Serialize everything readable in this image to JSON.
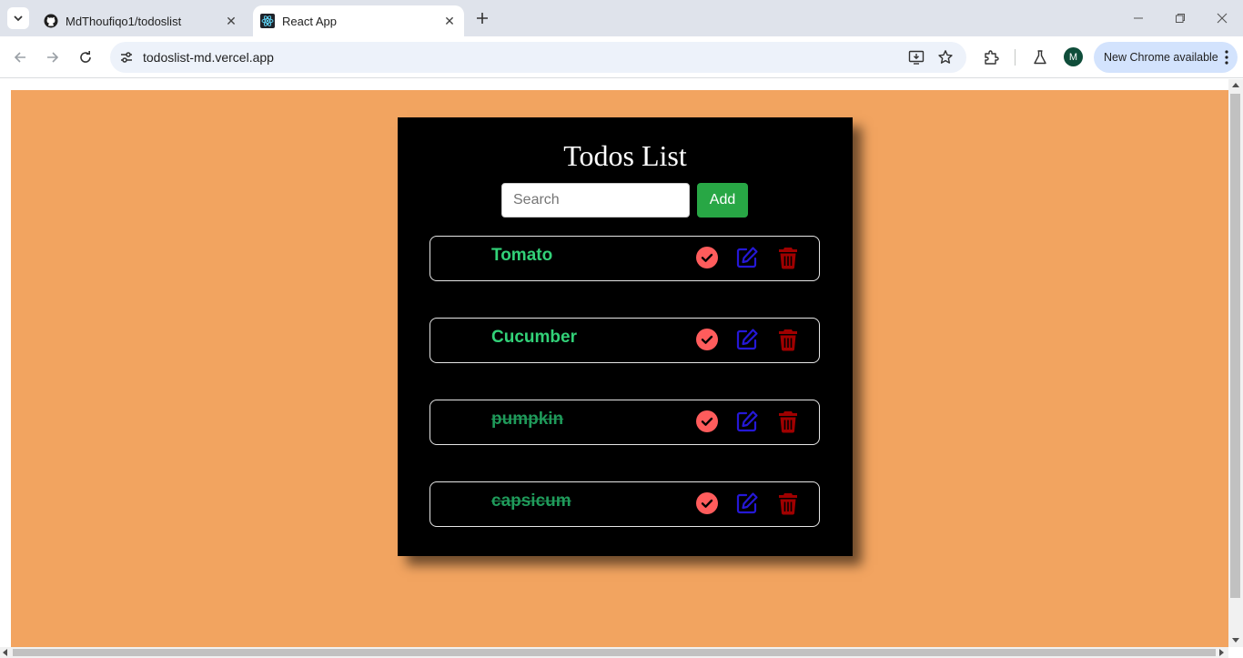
{
  "browser": {
    "tabs": [
      {
        "title": "MdThoufiqo1/todoslist",
        "icon": "github-icon",
        "active": false
      },
      {
        "title": "React App",
        "icon": "react-icon",
        "active": true
      }
    ],
    "address": "todoslist-md.vercel.app",
    "profile_initial": "M",
    "update_label": "New Chrome available"
  },
  "app": {
    "title": "Todos List",
    "search_placeholder": "Search",
    "search_value": "",
    "add_label": "Add",
    "colors": {
      "page_background": "#f2a460",
      "card": "#000000",
      "todo_text": "#32d178",
      "add_button": "#28a745",
      "done_icon": "#ff5c5c",
      "edit_icon": "#2518d6",
      "delete_icon": "#a00000"
    },
    "todos": [
      {
        "text": "Tomato",
        "completed": false
      },
      {
        "text": "Cucumber",
        "completed": false
      },
      {
        "text": "pumpkin",
        "completed": true
      },
      {
        "text": "capsicum",
        "completed": true
      }
    ],
    "icons": {
      "done": "check-circle-icon",
      "edit": "edit-icon",
      "delete": "trash-icon"
    }
  }
}
